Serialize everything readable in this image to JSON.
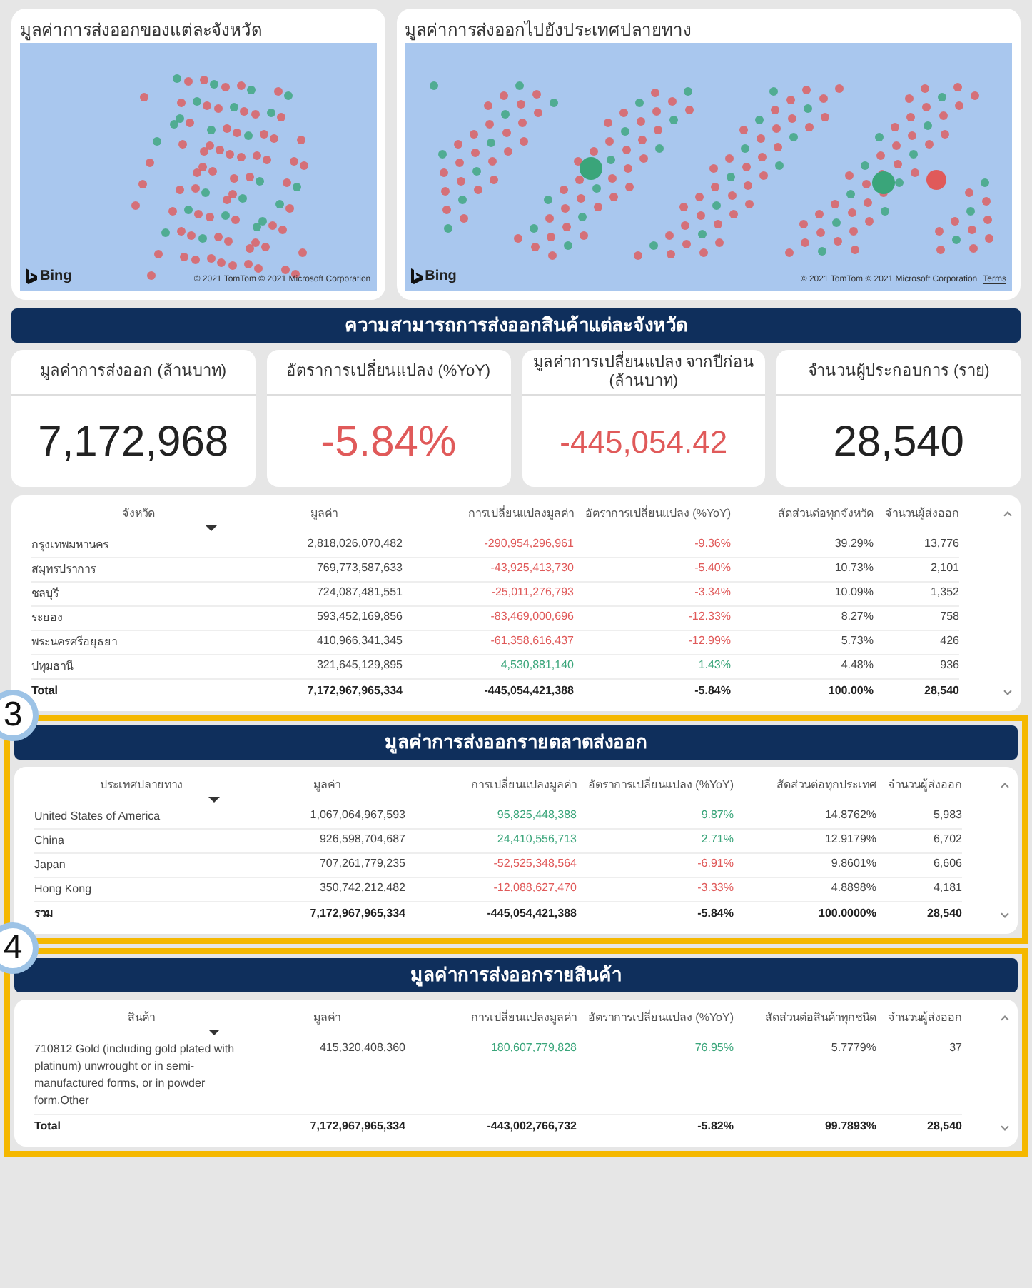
{
  "maps": [
    {
      "title": "มูลค่าการส่งออกของแต่ละจังหวัด",
      "logo": "Bing",
      "copyright": "© 2021 TomTom © 2021 Microsoft Corporation",
      "kind": "province"
    },
    {
      "title": "มูลค่าการส่งออกไปยังประเทศปลายทาง",
      "logo": "Bing",
      "copyright": "© 2021 TomTom © 2021 Microsoft Corporation",
      "terms": "Terms",
      "kind": "world"
    }
  ],
  "section_1": {
    "banner": "ความสามารถการส่งออกสินค้าแต่ละจังหวัด",
    "kpis": [
      {
        "label": "มูลค่าการส่งออก (ล้านบาท)",
        "value": "7,172,968",
        "color": "#222222"
      },
      {
        "label": "อัตราการเปลี่ยนแปลง (%YoY)",
        "value": "-5.84%",
        "color": "#e05a5a"
      },
      {
        "label": "มูลค่าการเปลี่ยนแปลง จากปีก่อน (ล้านบาท)",
        "value": "-445,054.42",
        "color": "#e05a5a"
      },
      {
        "label": "จำนวนผู้ประกอบการ (ราย)",
        "value": "28,540",
        "color": "#222222"
      }
    ],
    "table": {
      "columns": [
        "จังหวัด",
        "มูลค่า",
        "การเปลี่ยนแปลงมูลค่า",
        "อัตราการเปลี่ยนแปลง (%YoY)",
        "สัดส่วนต่อทุกจังหวัด",
        "จำนวนผู้ส่งออก"
      ],
      "rows": [
        {
          "cells": [
            "กรุงเทพมหานคร",
            "2,818,026,070,482",
            "-290,954,296,961",
            "-9.36%",
            "39.29%",
            "13,776"
          ],
          "color": "#e05a5a"
        },
        {
          "cells": [
            "สมุทรปราการ",
            "769,773,587,633",
            "-43,925,413,730",
            "-5.40%",
            "10.73%",
            "2,101"
          ],
          "color": "#e05a5a"
        },
        {
          "cells": [
            "ชลบุรี",
            "724,087,481,551",
            "-25,011,276,793",
            "-3.34%",
            "10.09%",
            "1,352"
          ],
          "color": "#e05a5a"
        },
        {
          "cells": [
            "ระยอง",
            "593,452,169,856",
            "-83,469,000,696",
            "-12.33%",
            "8.27%",
            "758"
          ],
          "color": "#e05a5a"
        },
        {
          "cells": [
            "พระนครศรีอยุธยา",
            "410,966,341,345",
            "-61,358,616,437",
            "-12.99%",
            "5.73%",
            "426"
          ],
          "color": "#e05a5a"
        },
        {
          "cells": [
            "ปทุมธานี",
            "321,645,129,895",
            "4,530,881,140",
            "1.43%",
            "4.48%",
            "936"
          ],
          "color": "#3aa57a"
        }
      ],
      "total": [
        "Total",
        "7,172,967,965,334",
        "-445,054,421,388",
        "-5.84%",
        "100.00%",
        "28,540"
      ]
    }
  },
  "section_2": {
    "callout": "3",
    "banner": "มูลค่าการส่งออกรายตลาดส่งออก",
    "table": {
      "columns": [
        "ประเทศปลายทาง",
        "มูลค่า",
        "การเปลี่ยนแปลงมูลค่า",
        "อัตราการเปลี่ยนแปลง (%YoY)",
        "สัดส่วนต่อทุกประเทศ",
        "จำนวนผู้ส่งออก"
      ],
      "rows": [
        {
          "cells": [
            "United States of America",
            "1,067,064,967,593",
            "95,825,448,388",
            "9.87%",
            "14.8762%",
            "5,983"
          ],
          "color": "#3aa57a"
        },
        {
          "cells": [
            "China",
            "926,598,704,687",
            "24,410,556,713",
            "2.71%",
            "12.9179%",
            "6,702"
          ],
          "color": "#3aa57a"
        },
        {
          "cells": [
            "Japan",
            "707,261,779,235",
            "-52,525,348,564",
            "-6.91%",
            "9.8601%",
            "6,606"
          ],
          "color": "#e05a5a"
        },
        {
          "cells": [
            "Hong Kong",
            "350,742,212,482",
            "-12,088,627,470",
            "-3.33%",
            "4.8898%",
            "4,181"
          ],
          "color": "#e05a5a"
        }
      ],
      "total": [
        "รวม",
        "7,172,967,965,334",
        "-445,054,421,388",
        "-5.84%",
        "100.0000%",
        "28,540"
      ]
    }
  },
  "section_3": {
    "callout": "4",
    "banner": "มูลค่าการส่งออกรายสินค้า",
    "table": {
      "columns": [
        "สินค้า",
        "มูลค่า",
        "การเปลี่ยนแปลงมูลค่า",
        "อัตราการเปลี่ยนแปลง (%YoY)",
        "สัดส่วนต่อสินค้าทุกชนิด",
        "จำนวนผู้ส่งออก"
      ],
      "rows": [
        {
          "cells": [
            "710812 Gold (including gold plated with platinum) unwrought or in semi-manufactured forms, or in powder form.Other",
            "415,320,408,360",
            "180,607,779,828",
            "76.95%",
            "5.7779%",
            "37"
          ],
          "color": "#3aa57a"
        }
      ],
      "total": [
        "Total",
        "7,172,967,965,334",
        "-443,002,766,732",
        "-5.82%",
        "99.7893%",
        "28,540"
      ]
    }
  }
}
